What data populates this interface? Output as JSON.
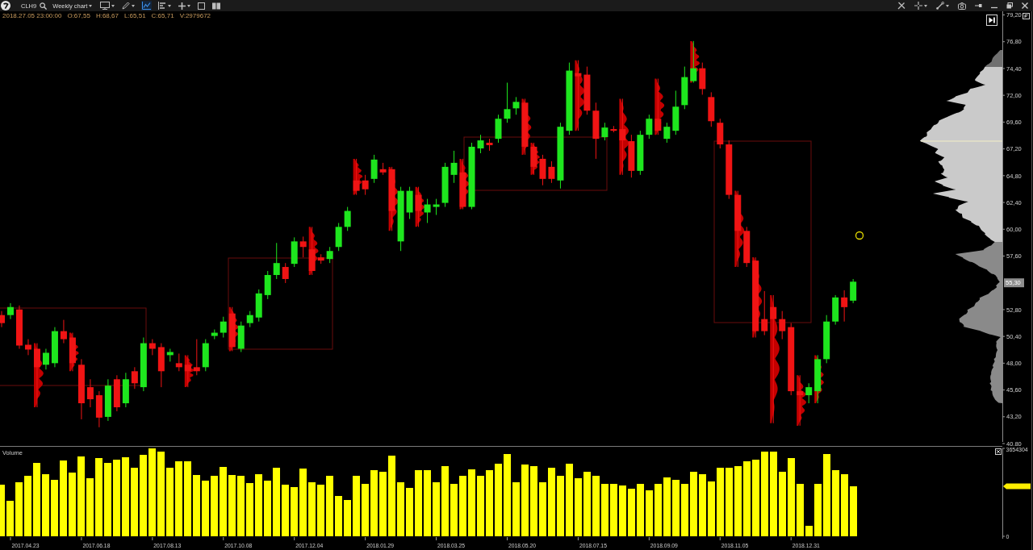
{
  "toolbar": {
    "symbol": "CLH9",
    "period": "Weekly chart",
    "tools": [
      {
        "has_menu": true,
        "selected": false
      },
      {
        "has_menu": true,
        "selected": false
      },
      {
        "has_menu": false,
        "selected": true
      },
      {
        "has_menu": true,
        "selected": false
      },
      {
        "has_menu": true,
        "selected": false
      },
      {
        "has_menu": false,
        "selected": false
      },
      {
        "has_menu": false,
        "selected": false
      }
    ],
    "right_tools": [
      {
        "has_menu": false
      },
      {
        "has_menu": true
      },
      {
        "has_menu": true
      },
      {
        "has_menu": false
      }
    ]
  },
  "bar_info": [
    "2018.27.05 23:00:00",
    "O:67,55",
    "H:68,67",
    "L:65,51",
    "C:65,71",
    "V:2979672"
  ],
  "price_axis": {
    "labels_above": [
      "79,20",
      "76,80",
      "74,40",
      "72,00",
      "69,60",
      "67,20",
      "64,80",
      "62,40",
      "60,00",
      "57,60"
    ],
    "current_price": "55,30",
    "labels_below": [
      "52,80",
      "50,40",
      "48,00",
      "45,60",
      "43,20",
      "40,80"
    ]
  },
  "volume_panel": {
    "date_labels": [
      "2017.04.23",
      "2017.06.18",
      "2017.08.13",
      "2017.10.08",
      "2017.12.04",
      "2018.01.29",
      "2018.03.25",
      "2018.05.20",
      "2018.07.15",
      "2018.09.09",
      "2018.11.05",
      "2018.12.31"
    ],
    "chart_data": {
      "type": "bar",
      "title": "Volume",
      "ylim": [
        0,
        3654304
      ],
      "yticks": [
        {
          "value": 3654304,
          "label": "3654304"
        },
        {
          "value": 0,
          "label": "0"
        }
      ],
      "series": [
        {
          "color": "#ffff00",
          "values": [
            2150000,
            1480000,
            2250000,
            2510000,
            3050000,
            2580000,
            2350000,
            3150000,
            2650000,
            3320000,
            2410000,
            3250000,
            3050000,
            3180000,
            3290000,
            2850000,
            3390000,
            3650000,
            3520000,
            2850000,
            3120000,
            3120000,
            2550000,
            2310000,
            2510000,
            2880000,
            2550000,
            2510000,
            2210000,
            2580000,
            2310000,
            2850000,
            2150000,
            2050000,
            2820000,
            2250000,
            2150000,
            2510000,
            1680000,
            1510000,
            2510000,
            2180000,
            2750000,
            2680000,
            3350000,
            2250000,
            2010000,
            2750000,
            2750000,
            2250000,
            2920000,
            2180000,
            2510000,
            2780000,
            2510000,
            2750000,
            3020000,
            3420000,
            2250000,
            2980000,
            2920000,
            2250000,
            2850000,
            2510000,
            3020000,
            2410000,
            2680000,
            2510000,
            2180000,
            2180000,
            2110000,
            1980000,
            2180000,
            1910000,
            2180000,
            2450000,
            2350000,
            2180000,
            2680000,
            2580000,
            2280000,
            2850000,
            2850000,
            2920000,
            3120000,
            3180000,
            3520000,
            3520000,
            2680000,
            3250000,
            2180000,
            440000,
            2180000,
            3420000,
            2750000,
            2580000,
            2080000,
            null,
            null,
            null,
            null,
            null,
            null,
            null,
            null,
            null,
            null,
            null,
            null,
            null,
            null,
            null,
            null
          ]
        }
      ]
    }
  }
}
